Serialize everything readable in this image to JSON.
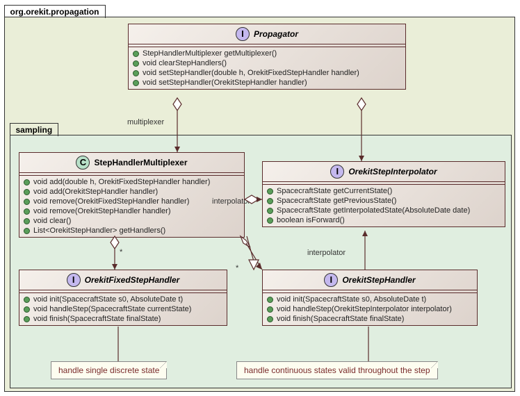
{
  "pkg": {
    "outer": "org.orekit.propagation",
    "inner": "sampling"
  },
  "propagator": {
    "name": "Propagator",
    "badge": "I",
    "methods": [
      "StepHandlerMultiplexer getMultiplexer()",
      "void clearStepHandlers()",
      "void setStepHandler(double h, OrekitFixedStepHandler handler)",
      "void setStepHandler(OrekitStepHandler handler)"
    ]
  },
  "multiplexer": {
    "name": "StepHandlerMultiplexer",
    "badge": "C",
    "methods": [
      "void add(double h, OrekitFixedStepHandler handler)",
      "void add(OrekitStepHandler handler)",
      "void remove(OrekitFixedStepHandler handler)",
      "void remove(OrekitStepHandler handler)",
      "void clear()",
      "List<OrekitStepHandler> getHandlers()"
    ]
  },
  "interpolator": {
    "name": "OrekitStepInterpolator",
    "badge": "I",
    "methods": [
      "SpacecraftState getCurrentState()",
      "SpacecraftState getPreviousState()",
      "SpacecraftState getInterpolatedState(AbsoluteDate date)",
      "boolean isForward()"
    ]
  },
  "fixedHandler": {
    "name": "OrekitFixedStepHandler",
    "badge": "I",
    "methods": [
      "void init(SpacecraftState s0, AbsoluteDate t)",
      "void handleStep(SpacecraftState currentState)",
      "void finish(SpacecraftState finalState)"
    ]
  },
  "stepHandler": {
    "name": "OrekitStepHandler",
    "badge": "I",
    "methods": [
      "void init(SpacecraftState s0, AbsoluteDate t)",
      "void handleStep(OrekitStepInterpolator interpolator)",
      "void finish(SpacecraftState finalState)"
    ]
  },
  "notes": {
    "fixed": "handle single discrete state",
    "step": "handle continuous states valid throughout the step"
  },
  "labels": {
    "multiplexer": "multiplexer",
    "interpolator": "interpolator",
    "interpolator2": "interpolator",
    "star": "*",
    "star2": "*"
  }
}
